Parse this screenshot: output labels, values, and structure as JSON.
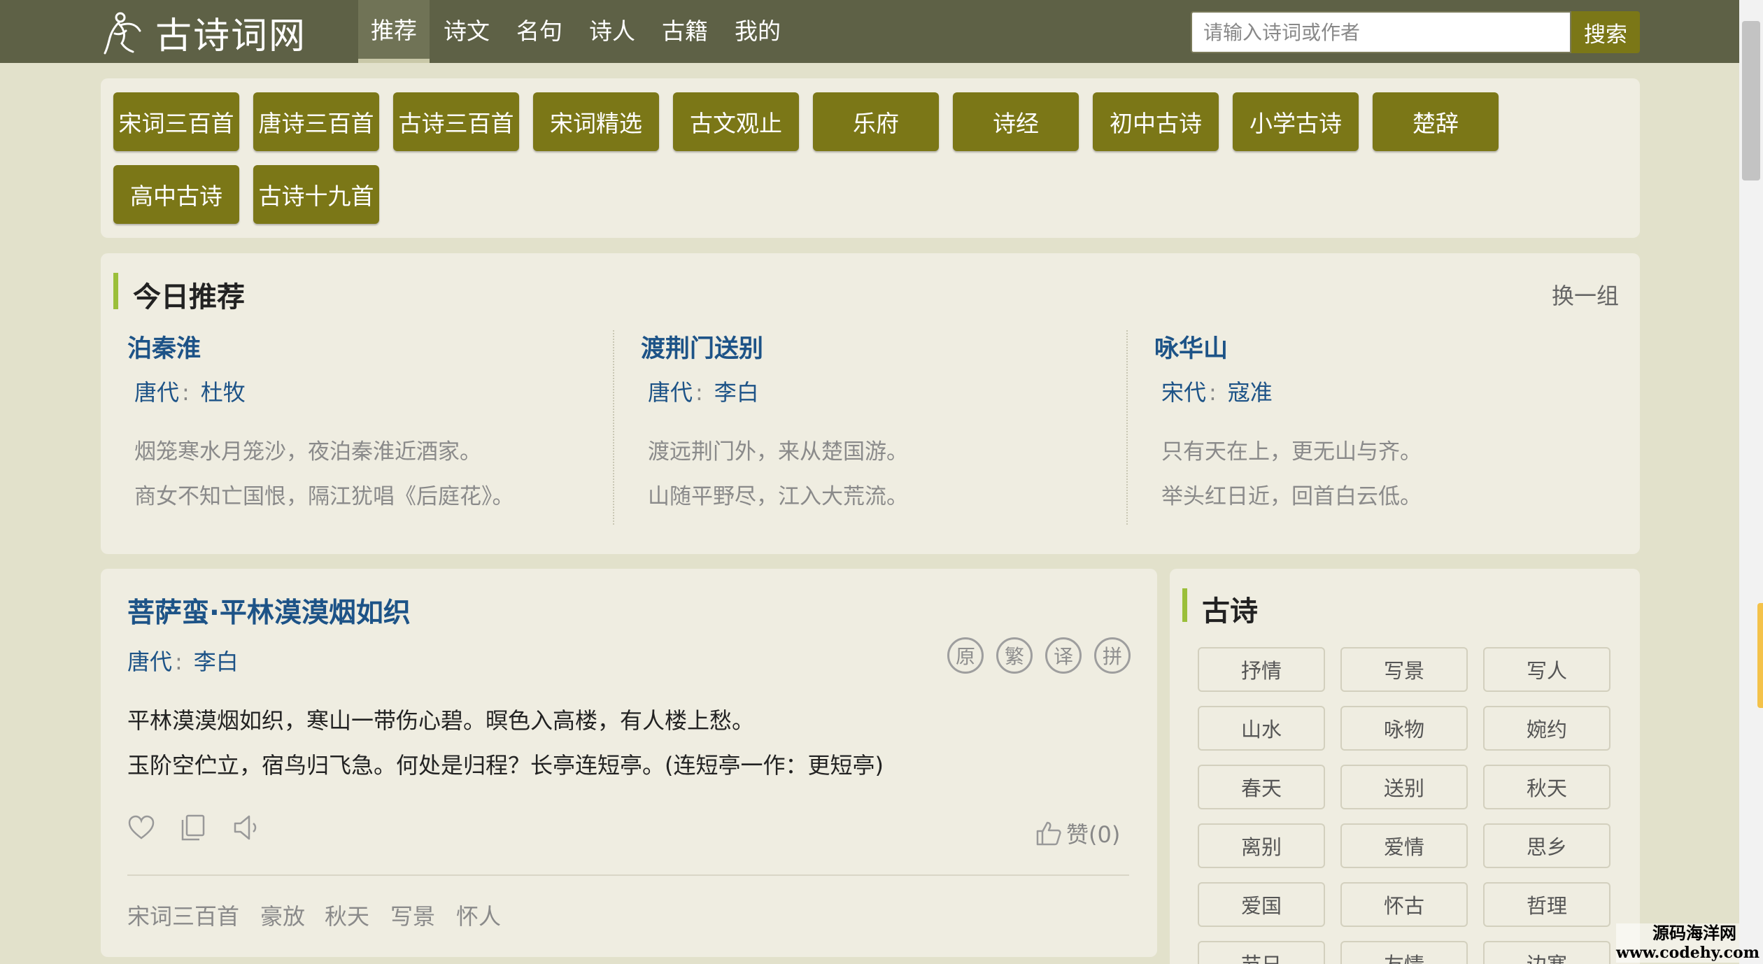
{
  "header": {
    "logo_text": "古诗词网",
    "nav": [
      "推荐",
      "诗文",
      "名句",
      "诗人",
      "古籍",
      "我的"
    ],
    "active_nav": "推荐",
    "search_placeholder": "请输入诗词或作者",
    "search_button": "搜索"
  },
  "categories": [
    "宋词三百首",
    "唐诗三百首",
    "古诗三百首",
    "宋词精选",
    "古文观止",
    "乐府",
    "诗经",
    "初中古诗",
    "小学古诗",
    "楚辞",
    "高中古诗",
    "古诗十九首"
  ],
  "today": {
    "title": "今日推荐",
    "swap": "换一组",
    "poems": [
      {
        "title": "泊秦淮",
        "dynasty": "唐代",
        "author": "杜牧",
        "lines": [
          "烟笼寒水月笼沙，夜泊秦淮近酒家。",
          "商女不知亡国恨，隔江犹唱《后庭花》。"
        ]
      },
      {
        "title": "渡荆门送别",
        "dynasty": "唐代",
        "author": "李白",
        "lines": [
          "渡远荆门外，来从楚国游。",
          "山随平野尽，江入大荒流。"
        ]
      },
      {
        "title": "咏华山",
        "dynasty": "宋代",
        "author": "寇准",
        "lines": [
          "只有天在上，更无山与齐。",
          "举头红日近，回首白云低。"
        ]
      }
    ]
  },
  "poem": {
    "title": "菩萨蛮·平林漠漠烟如织",
    "dynasty": "唐代",
    "author": "李白",
    "tools": [
      "原",
      "繁",
      "译",
      "拼"
    ],
    "lines": [
      "平林漠漠烟如织，寒山一带伤心碧。暝色入高楼，有人楼上愁。",
      "玉阶空伫立，宿鸟归飞急。何处是归程？长亭连短亭。(连短亭一作：更短亭)"
    ],
    "like_label": "赞(0)",
    "tags": [
      "宋词三百首",
      "豪放",
      "秋天",
      "写景",
      "怀人"
    ]
  },
  "sidebar": {
    "title": "古诗",
    "tags": [
      "抒情",
      "写景",
      "写人",
      "山水",
      "咏物",
      "婉约",
      "春天",
      "送别",
      "秋天",
      "离别",
      "爱情",
      "思乡",
      "爱国",
      "怀古",
      "哲理",
      "节日",
      "友情",
      "边塞"
    ]
  },
  "watermark": {
    "line1": "源码海洋网",
    "line2": "www.codehy.com"
  },
  "colors": {
    "header": "#5e6146",
    "accent": "#7b7717",
    "link": "#1d5387",
    "bar": "#9bbf3a",
    "panel": "#efede1",
    "page": "#e2e1cb"
  }
}
